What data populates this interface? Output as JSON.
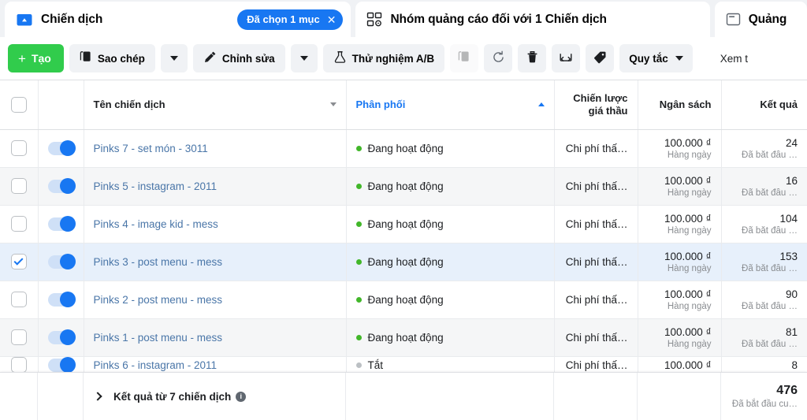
{
  "tabs": [
    {
      "id": "campaign",
      "label": "Chiến dịch",
      "icon": "campaign-folder-icon",
      "active": true
    },
    {
      "id": "adset",
      "label": "Nhóm quảng cáo đối với 1 Chiến dịch",
      "icon": "adset-grid-icon",
      "active": false
    },
    {
      "id": "ad",
      "label": "Quảng",
      "icon": "ad-window-icon",
      "active": false
    }
  ],
  "selected_pill": {
    "label": "Đã chọn 1 mục",
    "close": "✕"
  },
  "toolbar": {
    "create_label": "Tạo",
    "create_plus": "+",
    "duplicate_label": "Sao chép",
    "edit_label": "Chỉnh sửa",
    "abtest_label": "Thử nghiệm A/B",
    "rules_label": "Quy tắc",
    "view_label": "Xem t",
    "icons": {
      "duplicate": "copy-icon",
      "edit": "pencil-icon",
      "abtest": "flask-icon",
      "disabled_duplicate": "duplicate-disabled-icon",
      "refresh": "refresh-icon",
      "delete": "trash-icon",
      "export": "export-icon",
      "tag": "tag-icon"
    }
  },
  "table": {
    "columns": [
      {
        "key": "check",
        "label": ""
      },
      {
        "key": "toggle",
        "label": ""
      },
      {
        "key": "name",
        "label": "Tên chiến dịch",
        "sort": "down"
      },
      {
        "key": "delivery",
        "label": "Phân phối",
        "sort": "up",
        "active": true
      },
      {
        "key": "bid",
        "label_1": "Chiến lược",
        "label_2": "giá thầu"
      },
      {
        "key": "budget",
        "label": "Ngân sách"
      },
      {
        "key": "result",
        "label": "Kết quả"
      }
    ],
    "rows": [
      {
        "checked": false,
        "toggle": true,
        "name": "Pinks 7 - set món - 3011",
        "delivery": "Đang hoạt động",
        "delivery_state": "active",
        "bid": "Chi phí thấ…",
        "budget": "100.000 ₫",
        "budget_sub": "Hàng ngày",
        "result": "24",
        "result_sub": "Đã bắt đầu …"
      },
      {
        "checked": false,
        "toggle": true,
        "name": "Pinks 5 - instagram - 2011",
        "delivery": "Đang hoạt động",
        "delivery_state": "active",
        "bid": "Chi phí thấ…",
        "budget": "100.000 ₫",
        "budget_sub": "Hàng ngày",
        "result": "16",
        "result_sub": "Đã bắt đầu …"
      },
      {
        "checked": false,
        "toggle": true,
        "name": "Pinks 4 - image kid - mess",
        "delivery": "Đang hoạt động",
        "delivery_state": "active",
        "bid": "Chi phí thấ…",
        "budget": "100.000 ₫",
        "budget_sub": "Hàng ngày",
        "result": "104",
        "result_sub": "Đã bắt đầu …"
      },
      {
        "checked": true,
        "toggle": true,
        "name": "Pinks 3 - post menu - mess",
        "delivery": "Đang hoạt động",
        "delivery_state": "active",
        "bid": "Chi phí thấ…",
        "budget": "100.000 ₫",
        "budget_sub": "Hàng ngày",
        "result": "153",
        "result_sub": "Đã bắt đầu …"
      },
      {
        "checked": false,
        "toggle": true,
        "name": "Pinks 2 - post menu - mess",
        "delivery": "Đang hoạt động",
        "delivery_state": "active",
        "bid": "Chi phí thấ…",
        "budget": "100.000 ₫",
        "budget_sub": "Hàng ngày",
        "result": "90",
        "result_sub": "Đã bắt đầu …"
      },
      {
        "checked": false,
        "toggle": true,
        "name": "Pinks 1 - post menu - mess",
        "delivery": "Đang hoạt động",
        "delivery_state": "active",
        "bid": "Chi phí thấ…",
        "budget": "100.000 ₫",
        "budget_sub": "Hàng ngày",
        "result": "81",
        "result_sub": "Đã bắt đầu …"
      },
      {
        "checked": false,
        "toggle": false,
        "name": "Pinks 6 - instagram - 2011",
        "delivery": "Tắt",
        "delivery_state": "off",
        "bid": "Chi phí thấ…",
        "budget": "100.000 ₫",
        "budget_sub": "",
        "result": "8",
        "result_sub": ""
      }
    ]
  },
  "summary": {
    "label": "Kết quả từ 7 chiến dịch",
    "info": "i",
    "total": "476",
    "total_sub": "Đã bắt đầu cu…"
  },
  "colors": {
    "brand_blue": "#1877f2",
    "create_green": "#31cc4c",
    "active_green": "#42b72a",
    "link_blue": "#4a76a8",
    "selected_row": "#e7f0fb"
  }
}
